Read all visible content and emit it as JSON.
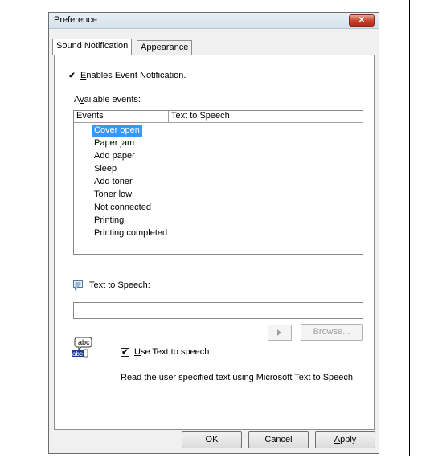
{
  "dialog": {
    "title": "Preference",
    "close_symbol": "✕"
  },
  "tabs": [
    {
      "label": "Sound Notification",
      "active": true
    },
    {
      "label": "Appearance",
      "active": false
    }
  ],
  "enable_events": {
    "checked": true,
    "label_underline": "E",
    "label_rest": "nables Event Notification."
  },
  "available_events": {
    "label_pre": "A",
    "label_underline": "v",
    "label_rest": "ailable events:"
  },
  "events_table": {
    "columns": [
      "Events",
      "Text to Speech"
    ],
    "rows": [
      {
        "event": "Cover open",
        "tts": "",
        "selected": true
      },
      {
        "event": "Paper jam",
        "tts": ""
      },
      {
        "event": "Add paper",
        "tts": ""
      },
      {
        "event": "Sleep",
        "tts": ""
      },
      {
        "event": "Add toner",
        "tts": ""
      },
      {
        "event": "Toner low",
        "tts": ""
      },
      {
        "event": "Not connected",
        "tts": ""
      },
      {
        "event": "Printing",
        "tts": ""
      },
      {
        "event": "Printing completed",
        "tts": ""
      }
    ]
  },
  "tts": {
    "label": "Text to Speech:",
    "input_value": "",
    "browse_label": "Browse...",
    "use_checked": true,
    "use_label_underline": "U",
    "use_label_rest": "se Text to speech",
    "description": "Read the user specified text using Microsoft Text to Speech.",
    "icon_abc_top": "abc",
    "icon_abc_bottom": "abc"
  },
  "buttons": {
    "ok": "OK",
    "cancel": "Cancel",
    "apply_underline": "A",
    "apply_rest": "pply"
  },
  "colors": {
    "selection": "#3399ff",
    "close_button": "#c9412b",
    "dialog_bg": "#f0f0f0"
  }
}
